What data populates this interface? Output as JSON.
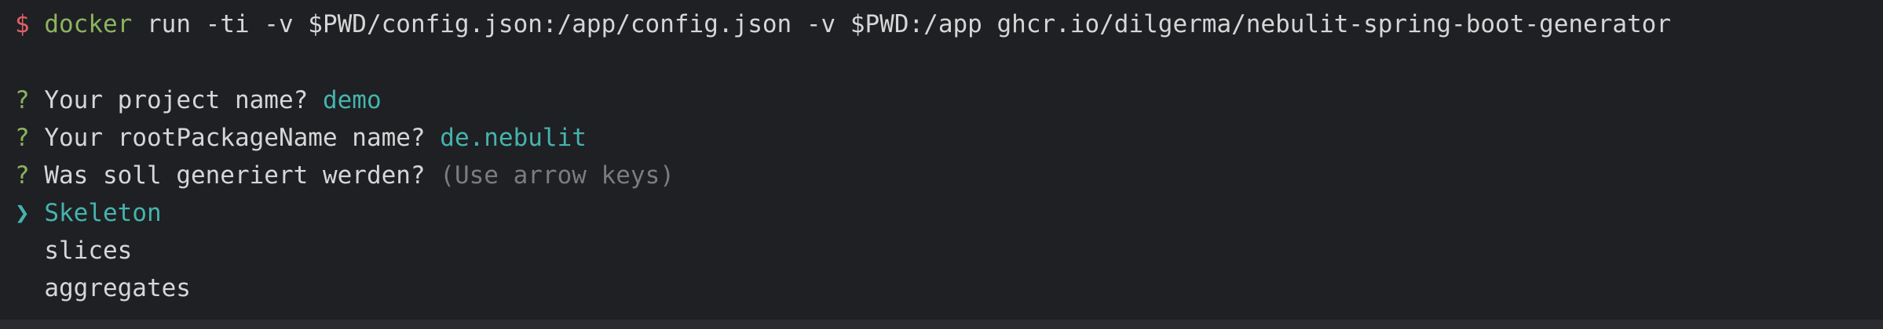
{
  "terminal": {
    "prev_line_fragment": "                                  ",
    "command": {
      "prompt": "$",
      "program": "docker",
      "args": "run -ti -v $PWD/config.json:/app/config.json -v $PWD:/app ghcr.io/dilgerma/nebulit-spring-boot-generator"
    },
    "questions": [
      {
        "mark": "?",
        "text": "Your project name?",
        "answer": "demo"
      },
      {
        "mark": "?",
        "text": "Your rootPackageName name?",
        "answer": "de.nebulit"
      },
      {
        "mark": "?",
        "text": "Was soll generiert werden?",
        "hint": "(Use arrow keys)"
      }
    ],
    "choices": {
      "pointer": "❯",
      "items": [
        "Skeleton",
        "slices",
        "aggregates"
      ],
      "selected_index": 0
    }
  },
  "colors": {
    "background": "#1f2024",
    "prompt": "#e0616a",
    "green": "#8bb55e",
    "cyan": "#45b4ad",
    "text": "#d6d6d6",
    "hint": "#7c7c80"
  }
}
